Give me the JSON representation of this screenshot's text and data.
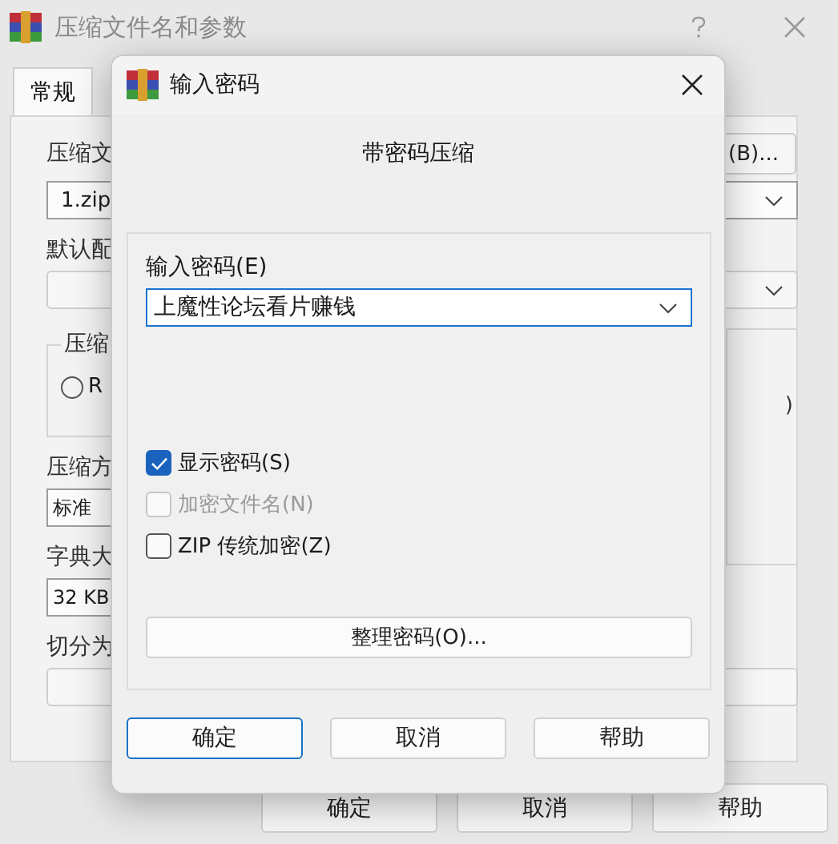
{
  "main_window": {
    "title": "压缩文件名和参数",
    "tabs": [
      {
        "label": "常规",
        "selected": true
      }
    ],
    "archive_name": {
      "label": "压缩文",
      "value": "1.zip"
    },
    "browse_button": "(B)...",
    "profile": {
      "label": "默认配"
    },
    "format_group": {
      "title": "压缩",
      "options": [
        {
          "label": "R",
          "selected": false
        }
      ]
    },
    "right_group_text": ")",
    "method": {
      "label": "压缩方",
      "value": "标准"
    },
    "dictionary": {
      "label": "字典大",
      "value": "32 KB"
    },
    "split": {
      "label": "切分为"
    },
    "buttons": [
      "确定",
      "取消",
      "帮助"
    ]
  },
  "password_dialog": {
    "title": "输入密码",
    "heading": "带密码压缩",
    "password": {
      "label": "输入密码(E)",
      "value": "上魔性论坛看片赚钱",
      "focused": true
    },
    "options": [
      {
        "label": "显示密码(S)",
        "checked": true,
        "disabled": false
      },
      {
        "label": "加密文件名(N)",
        "checked": false,
        "disabled": true
      },
      {
        "label": "ZIP 传统加密(Z)",
        "checked": false,
        "disabled": false
      }
    ],
    "organize_button": "整理密码(O)...",
    "buttons": [
      {
        "label": "确定",
        "default": true
      },
      {
        "label": "取消",
        "default": false
      },
      {
        "label": "帮助",
        "default": false
      }
    ]
  }
}
